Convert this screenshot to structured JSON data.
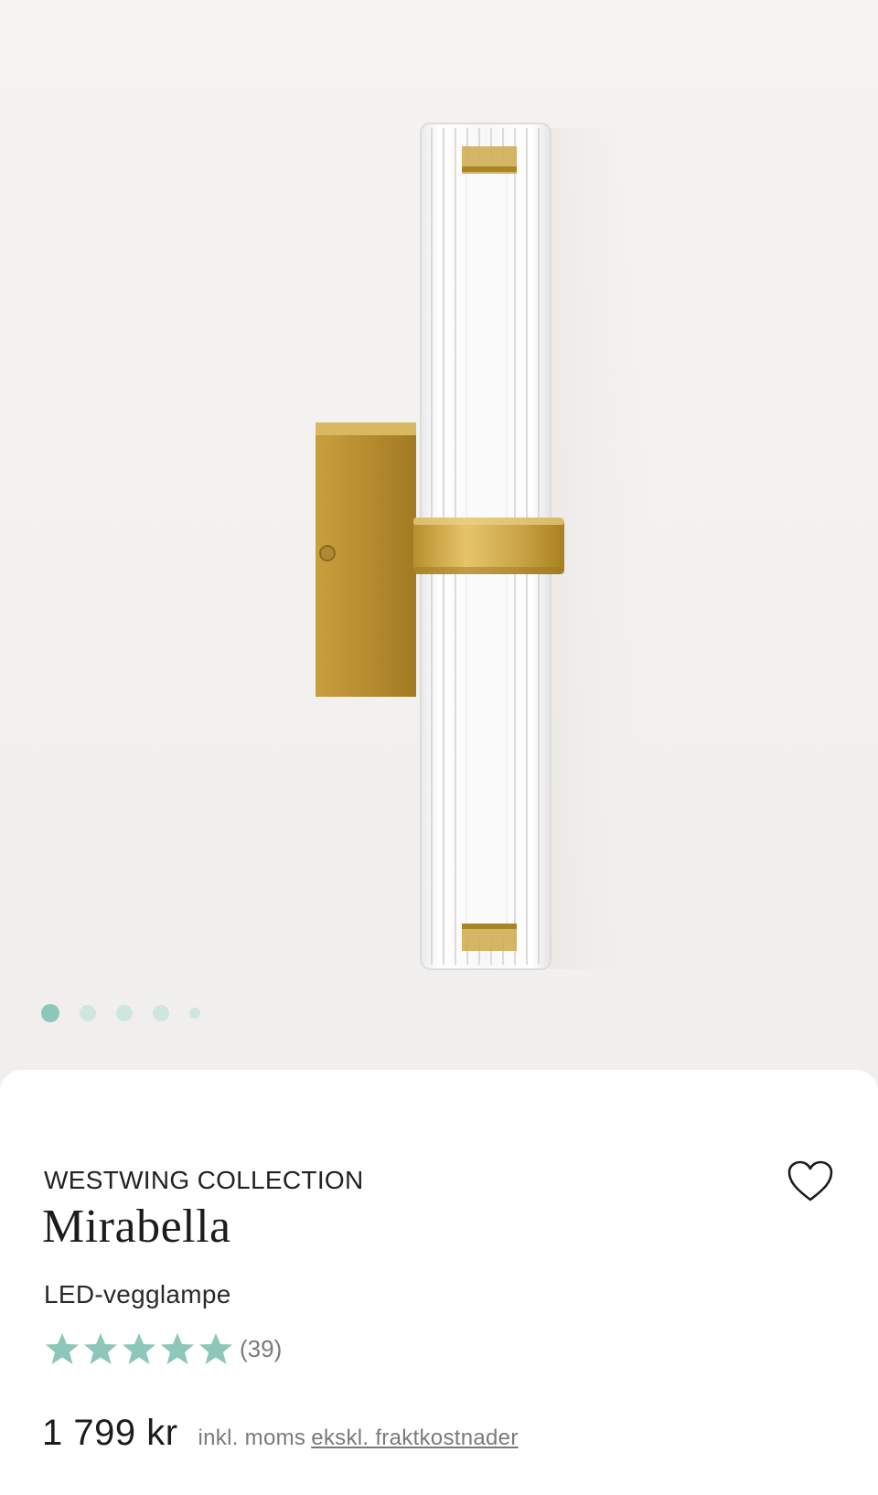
{
  "product": {
    "brand": "WESTWING COLLECTION",
    "name": "Mirabella",
    "type": "LED-vegglampe",
    "rating": 5,
    "review_count": "(39)",
    "price": "1 799 kr",
    "vat_note": "inkl. moms",
    "shipping_note": "ekskl. fraktkostnader"
  },
  "gallery": {
    "image_count": 5,
    "active_index": 0
  },
  "colors": {
    "accent": "#8cc7ba",
    "brass": "#c9a544",
    "text": "#1c1c1c",
    "muted": "#7a7a7a"
  },
  "icons": {
    "wishlist": "heart-icon",
    "rating": "star-icon"
  }
}
